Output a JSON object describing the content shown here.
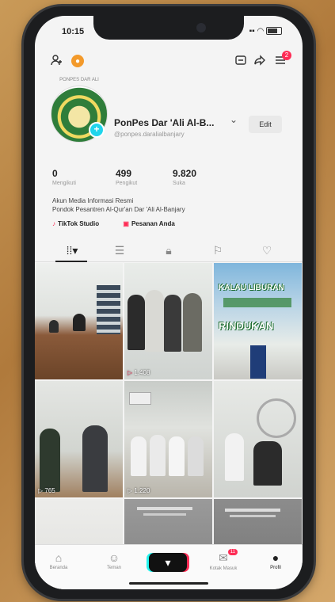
{
  "status": {
    "time": "10:15"
  },
  "profile": {
    "display_name": "PonPes Dar 'Ali Al-B...",
    "username": "@ponpes.daralialbanjary",
    "avatar_caption": "PONPES DAR ALI",
    "edit_label": "Edit",
    "stats": [
      {
        "value": "0",
        "label": "Mengikuti"
      },
      {
        "value": "499",
        "label": "Pengikut"
      },
      {
        "value": "9.820",
        "label": "Suka"
      }
    ],
    "bio_line1": "Akun Media Informasi Resmi",
    "bio_line2": "Pondok Pesantren Al-Qur'an Dar 'Ali Al-Banjary",
    "link1": "TikTok Studio",
    "link2": "Pesanan Anda",
    "inbox_badge": "2"
  },
  "videos": [
    {
      "views": "",
      "theme": "office"
    },
    {
      "views": "1.408",
      "theme": "girls"
    },
    {
      "views": "",
      "theme": "poster",
      "title1": "KALAU LIBURAN",
      "title2": "RINDUKAN"
    },
    {
      "views": "765",
      "theme": "hallway"
    },
    {
      "views": "1.220",
      "theme": "class"
    },
    {
      "views": "",
      "theme": "room"
    },
    {
      "views": "",
      "theme": "blank"
    },
    {
      "views": "",
      "theme": "slide"
    },
    {
      "views": "",
      "theme": "slide2"
    }
  ],
  "nav": {
    "items": [
      {
        "label": "Beranda"
      },
      {
        "label": "Teman"
      },
      {
        "label": "Kotak Masuk",
        "badge": "11"
      },
      {
        "label": "Profil"
      }
    ]
  },
  "colors": {
    "accent": "#fe2c55",
    "cyan": "#25f4ee",
    "brand_green": "#2f7d3a"
  }
}
